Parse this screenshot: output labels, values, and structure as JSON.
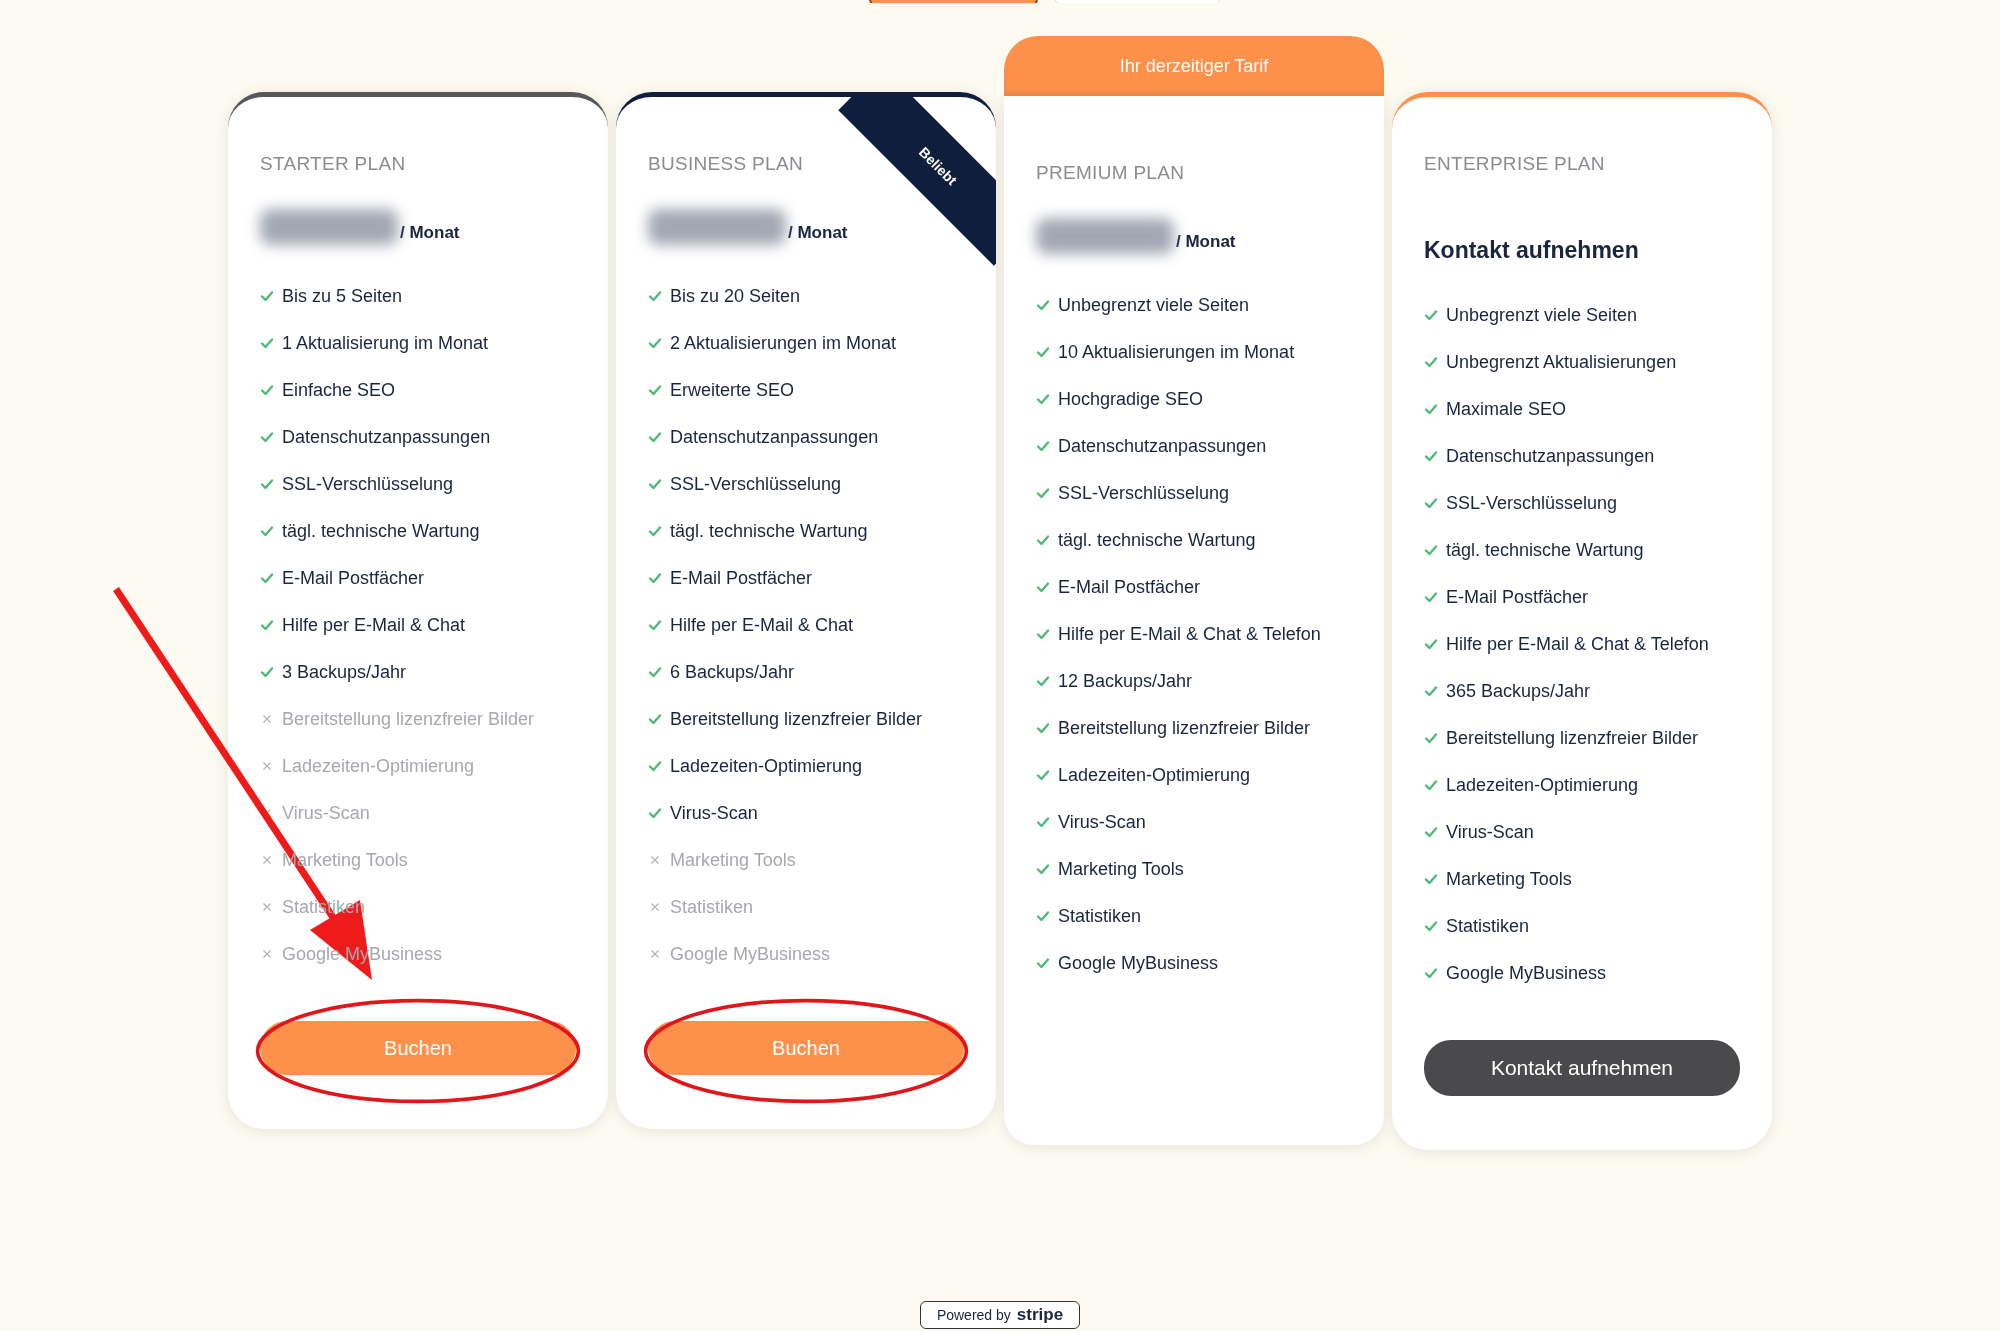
{
  "plans": [
    {
      "name": "STARTER PLAN",
      "color": "#58585a",
      "price_hidden": true,
      "period": "/ Monat",
      "circled": true,
      "button": {
        "label": "Buchen",
        "kind": "primary"
      },
      "features": [
        {
          "text": "Bis zu 5 Seiten",
          "included": true
        },
        {
          "text": "1 Aktualisierung im Monat",
          "included": true
        },
        {
          "text": "Einfache SEO",
          "included": true
        },
        {
          "text": "Datenschutzanpassungen",
          "included": true
        },
        {
          "text": "SSL-Verschlüsselung",
          "included": true
        },
        {
          "text": "tägl. technische Wartung",
          "included": true
        },
        {
          "text": "E-Mail Postfächer",
          "included": true
        },
        {
          "text": "Hilfe per E-Mail & Chat",
          "included": true
        },
        {
          "text": "3 Backups/Jahr",
          "included": true
        },
        {
          "text": "Bereitstellung lizenzfreier Bilder",
          "included": false
        },
        {
          "text": "Ladezeiten-Optimierung",
          "included": false
        },
        {
          "text": "Virus-Scan",
          "included": false
        },
        {
          "text": "Marketing Tools",
          "included": false
        },
        {
          "text": "Statistiken",
          "included": false
        },
        {
          "text": "Google MyBusiness",
          "included": false
        }
      ]
    },
    {
      "name": "BUSINESS PLAN",
      "color": "#0f1e3d",
      "ribbon": "Beliebt",
      "price_hidden": true,
      "period": "/ Monat",
      "circled": true,
      "button": {
        "label": "Buchen",
        "kind": "primary"
      },
      "features": [
        {
          "text": "Bis zu 20 Seiten",
          "included": true
        },
        {
          "text": "2 Aktualisierungen im Monat",
          "included": true
        },
        {
          "text": "Erweiterte SEO",
          "included": true
        },
        {
          "text": "Datenschutzanpassungen",
          "included": true
        },
        {
          "text": "SSL-Verschlüsselung",
          "included": true
        },
        {
          "text": "tägl. technische Wartung",
          "included": true
        },
        {
          "text": "E-Mail Postfächer",
          "included": true
        },
        {
          "text": "Hilfe per E-Mail & Chat",
          "included": true
        },
        {
          "text": "6 Backups/Jahr",
          "included": true
        },
        {
          "text": "Bereitstellung lizenzfreier Bilder",
          "included": true
        },
        {
          "text": "Ladezeiten-Optimierung",
          "included": true
        },
        {
          "text": "Virus-Scan",
          "included": true
        },
        {
          "text": "Marketing Tools",
          "included": false
        },
        {
          "text": "Statistiken",
          "included": false
        },
        {
          "text": "Google MyBusiness",
          "included": false
        }
      ]
    },
    {
      "name": "PREMIUM PLAN",
      "color": "#fd914c",
      "current_label": "Ihr derzeitiger Tarif",
      "price_hidden": true,
      "period": "/ Monat",
      "features": [
        {
          "text": "Unbegrenzt viele Seiten",
          "included": true
        },
        {
          "text": "10 Aktualisierungen im Monat",
          "included": true
        },
        {
          "text": "Hochgradige SEO",
          "included": true
        },
        {
          "text": "Datenschutzanpassungen",
          "included": true
        },
        {
          "text": "SSL-Verschlüsselung",
          "included": true
        },
        {
          "text": "tägl. technische Wartung",
          "included": true
        },
        {
          "text": "E-Mail Postfächer",
          "included": true
        },
        {
          "text": "Hilfe per E-Mail & Chat & Telefon",
          "included": true
        },
        {
          "text": "12 Backups/Jahr",
          "included": true
        },
        {
          "text": "Bereitstellung lizenzfreier Bilder",
          "included": true
        },
        {
          "text": "Ladezeiten-Optimierung",
          "included": true
        },
        {
          "text": "Virus-Scan",
          "included": true
        },
        {
          "text": "Marketing Tools",
          "included": true
        },
        {
          "text": "Statistiken",
          "included": true
        },
        {
          "text": "Google MyBusiness",
          "included": true
        }
      ]
    },
    {
      "name": "ENTERPRISE PLAN",
      "color": "#fd914c",
      "contact_heading": "Kontakt aufnehmen",
      "circled": false,
      "button": {
        "label": "Kontakt aufnehmen",
        "kind": "dark"
      },
      "features": [
        {
          "text": "Unbegrenzt viele Seiten",
          "included": true
        },
        {
          "text": "Unbegrenzt Aktualisierungen",
          "included": true
        },
        {
          "text": "Maximale SEO",
          "included": true
        },
        {
          "text": "Datenschutzanpassungen",
          "included": true
        },
        {
          "text": "SSL-Verschlüsselung",
          "included": true
        },
        {
          "text": "tägl. technische Wartung",
          "included": true
        },
        {
          "text": "E-Mail Postfächer",
          "included": true
        },
        {
          "text": "Hilfe per E-Mail & Chat & Telefon",
          "included": true
        },
        {
          "text": "365 Backups/Jahr",
          "included": true
        },
        {
          "text": "Bereitstellung lizenzfreier Bilder",
          "included": true
        },
        {
          "text": "Ladezeiten-Optimierung",
          "included": true
        },
        {
          "text": "Virus-Scan",
          "included": true
        },
        {
          "text": "Marketing Tools",
          "included": true
        },
        {
          "text": "Statistiken",
          "included": true
        },
        {
          "text": "Google MyBusiness",
          "included": true
        }
      ]
    }
  ],
  "markup": {
    "arrow": true
  },
  "footer": {
    "prefix": "Powered by",
    "brand": "stripe"
  }
}
